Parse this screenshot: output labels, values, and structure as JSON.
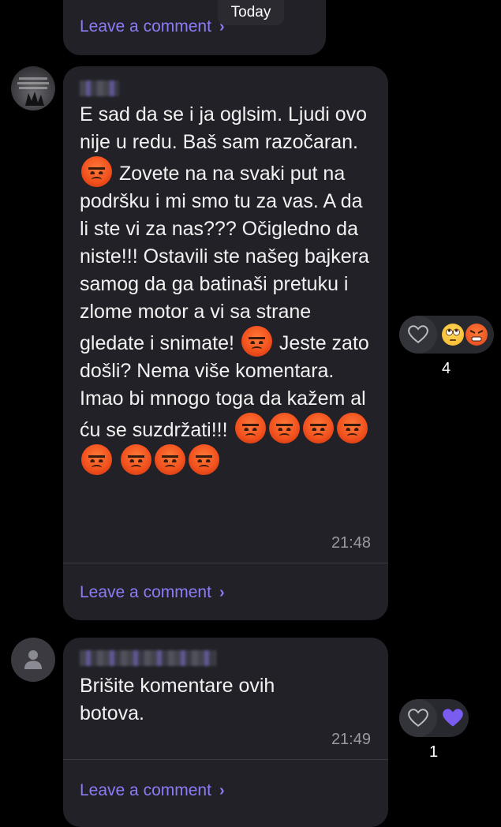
{
  "date_separator": "Today",
  "comments": [
    {
      "leave_comment_label": "Leave a comment",
      "chevron": "chevron-right-icon"
    },
    {
      "text_parts": [
        "E sad da se i ja oglsim. Ljudi ovo nije u redu. Baš sam razočaran.",
        "Zovete na na svaki put na podršku i mi smo tu za vas. A da li ste vi za nas??? Očigledno da niste!!! Ostavili ste našeg bajkera samog da ga batinaši pretuku i zlome motor a vi sa strane gledate i snimate!",
        "Jeste zato došli? Nema više komentara. Imao bi mnogo toga da kažem al ću se suzdržati!!!"
      ],
      "emoji": "angry-face",
      "time": "21:48",
      "leave_comment_label": "Leave a comment",
      "reactions": {
        "icons": [
          "heart-icon",
          "face-with-rolling-eyes",
          "angry-face"
        ],
        "count": "4"
      }
    },
    {
      "text": "Brišite komentare ovih botova.",
      "time": "21:49",
      "leave_comment_label": "Leave a comment",
      "reactions": {
        "icons": [
          "heart-icon",
          "purple-heart"
        ],
        "count": "1"
      }
    }
  ],
  "colors": {
    "accent": "#8b7cf6",
    "bubble": "#212127",
    "background": "#000000"
  }
}
